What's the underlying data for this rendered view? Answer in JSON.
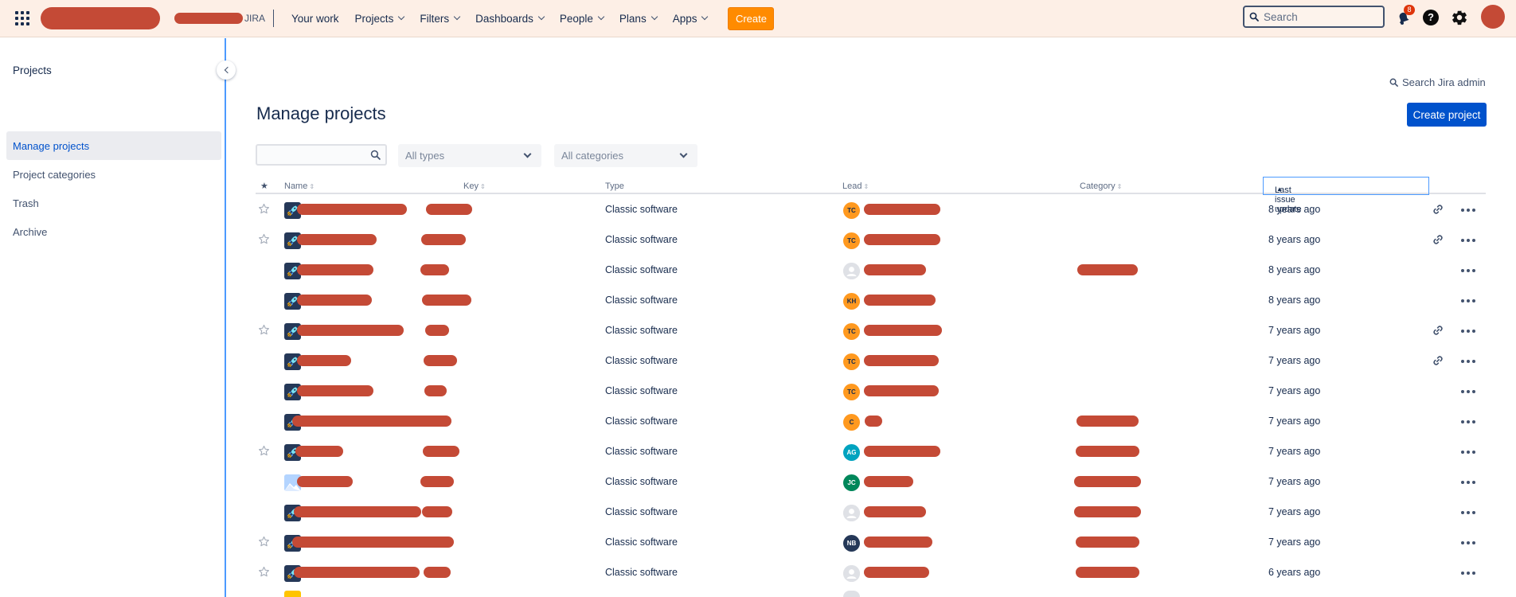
{
  "topbar": {
    "site_suffix": "JIRA",
    "nav": [
      {
        "label": "Your work",
        "dropdown": false
      },
      {
        "label": "Projects",
        "dropdown": true
      },
      {
        "label": "Filters",
        "dropdown": true
      },
      {
        "label": "Dashboards",
        "dropdown": true
      },
      {
        "label": "People",
        "dropdown": true
      },
      {
        "label": "Plans",
        "dropdown": true
      },
      {
        "label": "Apps",
        "dropdown": true
      }
    ],
    "create_label": "Create",
    "search_placeholder": "Search",
    "notification_count": "8",
    "help_glyph": "?"
  },
  "sidebar": {
    "title": "Projects",
    "items": [
      {
        "label": "Manage projects",
        "active": true
      },
      {
        "label": "Project categories",
        "active": false
      },
      {
        "label": "Trash",
        "active": false
      },
      {
        "label": "Archive",
        "active": false
      }
    ]
  },
  "main": {
    "admin_search": "Search Jira admin",
    "title": "Manage projects",
    "create_project": "Create project",
    "filters": {
      "search_value": "",
      "types_label": "All types",
      "categories_label": "All categories"
    },
    "columns": {
      "star": "★",
      "name": "Name",
      "key": "Key",
      "type": "Type",
      "lead": "Lead",
      "category": "Category",
      "last_update": "Last issue update"
    },
    "rows": [
      {
        "starred": true,
        "icon": "rocket",
        "type": "Classic software",
        "lead_initials": "TC",
        "lead_color": "#ff991f",
        "updated": "8 years ago",
        "link": true,
        "has_category": false,
        "nw": 138,
        "nx": 52,
        "kx": 214,
        "kw": 58,
        "lw": 96,
        "cw": 0
      },
      {
        "starred": true,
        "icon": "rocket",
        "type": "Classic software",
        "lead_initials": "TC",
        "lead_color": "#ff991f",
        "updated": "8 years ago",
        "link": true,
        "has_category": false,
        "nw": 100,
        "nx": 52,
        "kx": 208,
        "kw": 56,
        "lw": 96,
        "cw": 0
      },
      {
        "starred": false,
        "icon": "rocket",
        "type": "Classic software",
        "lead_initials": "",
        "lead_color": "#dfe1e6",
        "updated": "8 years ago",
        "link": false,
        "has_category": true,
        "nw": 96,
        "nx": 52,
        "kx": 207,
        "kw": 36,
        "lw": 78,
        "cw": 76
      },
      {
        "starred": false,
        "icon": "rocket",
        "type": "Classic software",
        "lead_initials": "KH",
        "lead_color": "#ff991f",
        "updated": "8 years ago",
        "link": false,
        "has_category": false,
        "nw": 94,
        "nx": 52,
        "kx": 209,
        "kw": 62,
        "lw": 90,
        "cw": 0
      },
      {
        "starred": true,
        "icon": "rocket",
        "type": "Classic software",
        "lead_initials": "TC",
        "lead_color": "#ff991f",
        "updated": "7 years ago",
        "link": true,
        "has_category": false,
        "nw": 134,
        "nx": 52,
        "kx": 213,
        "kw": 30,
        "lw": 98,
        "cw": 0
      },
      {
        "starred": false,
        "icon": "rocket",
        "type": "Classic software",
        "lead_initials": "TC",
        "lead_color": "#ff991f",
        "updated": "7 years ago",
        "link": true,
        "has_category": false,
        "nw": 68,
        "nx": 52,
        "kx": 211,
        "kw": 42,
        "lw": 94,
        "cw": 0
      },
      {
        "starred": false,
        "icon": "rocket",
        "type": "Classic software",
        "lead_initials": "TC",
        "lead_color": "#ff991f",
        "updated": "7 years ago",
        "link": false,
        "has_category": false,
        "nw": 96,
        "nx": 52,
        "kx": 212,
        "kw": 28,
        "lw": 94,
        "cw": 0
      },
      {
        "starred": false,
        "icon": "rocket",
        "type": "Classic software",
        "lead_initials": "C",
        "lead_color": "#ff991f",
        "updated": "7 years ago",
        "link": false,
        "has_category": true,
        "nw": 186,
        "nx": 46,
        "kx": 206,
        "kw": 40,
        "lw": 22,
        "cw": 78
      },
      {
        "starred": true,
        "icon": "rocket",
        "type": "Classic software",
        "lead_initials": "AG",
        "lead_color": "#00a3bf",
        "updated": "7 years ago",
        "link": false,
        "has_category": true,
        "nw": 60,
        "nx": 50,
        "kx": 210,
        "kw": 46,
        "lw": 96,
        "cw": 80
      },
      {
        "starred": false,
        "icon": "image",
        "type": "Classic software",
        "lead_initials": "JC",
        "lead_color": "#00875a",
        "updated": "7 years ago",
        "link": false,
        "has_category": true,
        "nw": 70,
        "nx": 52,
        "kx": 207,
        "kw": 42,
        "lw": 62,
        "cw": 84
      },
      {
        "starred": false,
        "icon": "rocket",
        "type": "Classic software",
        "lead_initials": "",
        "lead_color": "#dfe1e6",
        "updated": "7 years ago",
        "link": false,
        "has_category": true,
        "nw": 160,
        "nx": 48,
        "kx": 209,
        "kw": 38,
        "lw": 78,
        "cw": 84
      },
      {
        "starred": true,
        "icon": "rocket",
        "type": "Classic software",
        "lead_initials": "NB",
        "lead_color": "#253858",
        "updated": "7 years ago",
        "link": false,
        "has_category": true,
        "nw": 186,
        "nx": 46,
        "kx": 211,
        "kw": 38,
        "lw": 86,
        "cw": 80
      },
      {
        "starred": true,
        "icon": "rocket",
        "type": "Classic software",
        "lead_initials": "",
        "lead_color": "#dfe1e6",
        "updated": "6 years ago",
        "link": false,
        "has_category": true,
        "nw": 158,
        "nx": 48,
        "kx": 211,
        "kw": 34,
        "lw": 82,
        "cw": 80
      }
    ]
  }
}
